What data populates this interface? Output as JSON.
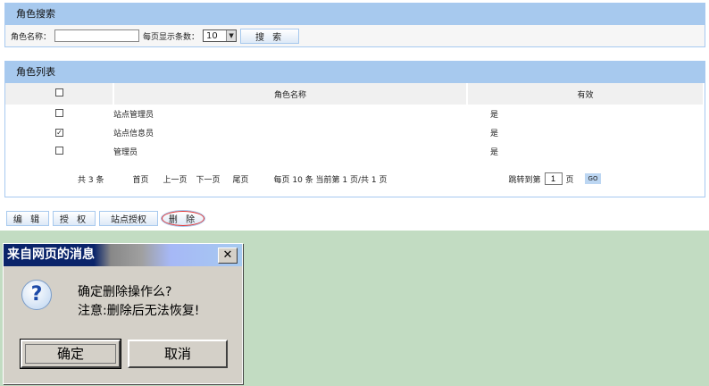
{
  "search": {
    "title": "角色搜索",
    "name_label": "角色名称：",
    "name_value": "",
    "page_size_label": "每页显示条数：",
    "page_size": "10",
    "search_button": "搜 索"
  },
  "list": {
    "title": "角色列表",
    "columns": [
      "角色名称",
      "有效"
    ],
    "rows": [
      {
        "name": "站点管理员",
        "valid": "是",
        "checked": false
      },
      {
        "name": "站点信息员",
        "valid": "是",
        "checked": true
      },
      {
        "name": "管理员",
        "valid": "是",
        "checked": false
      }
    ],
    "pager": {
      "total": "共 3 条",
      "first": "首页",
      "prev": "上一页",
      "next": "下一页",
      "last": "尾页",
      "info": "每页 10 条 当前第 1 页/共 1 页",
      "jump_label": "跳转到第",
      "jump_value": "1",
      "page_unit": "页",
      "go": "GO"
    }
  },
  "actions": {
    "edit": "编 辑",
    "grant": "授 权",
    "site_grant": "站点授权",
    "delete": "删 除"
  },
  "dialog": {
    "title": "来自网页的消息",
    "line1": "确定删除操作么?",
    "line2": "注意:删除后无法恢复!",
    "ok": "确定",
    "cancel": "取消"
  }
}
